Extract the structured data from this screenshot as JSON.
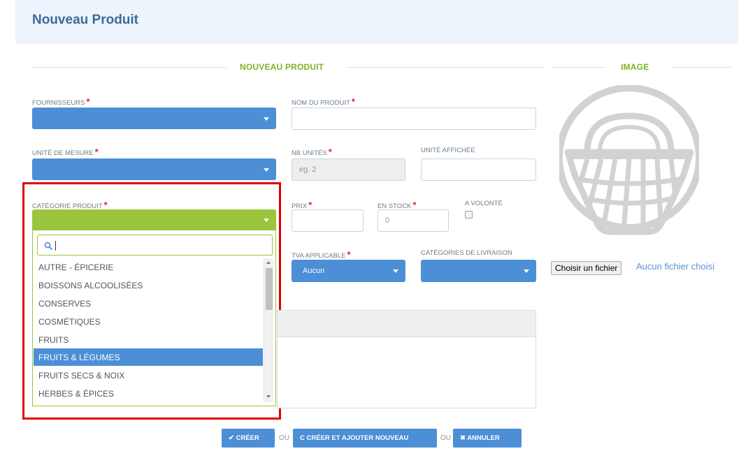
{
  "header": {
    "title": "Nouveau Produit"
  },
  "sections": {
    "product_title": "NOUVEAU PRODUIT",
    "image_title": "IMAGE"
  },
  "colors": {
    "accent_green": "#9bc53d",
    "primary_blue": "#4c8fd6",
    "required_red": "#e02a2a",
    "highlight_red": "#e00000"
  },
  "form": {
    "fournisseurs_label": "FOURNISSEURS",
    "nom_produit_label": "NOM DU PRODUIT",
    "unite_mesure_label": "UNITÉ DE MESURE",
    "nb_unites_label": "NB UNITÉS",
    "nb_unites_placeholder": "eg. 2",
    "unite_affichee_label": "UNITÉ AFFICHÉE",
    "categorie_label": "CATÉGORIE PRODUIT",
    "prix_label": "PRIX",
    "en_stock_label": "EN STOCK",
    "en_stock_value": "0",
    "a_volonte_label": "A VOLONTÉ",
    "tva_label": "TVA APPLICABLE",
    "tva_value": "Aucun",
    "livraison_label": "CATÉGORIES DE LIVRAISON",
    "required_mark": "*"
  },
  "dropdown": {
    "options": [
      "AUTRE - ÉPICERIE",
      "BOISSONS ALCOOLISÉES",
      "CONSERVES",
      "COSMÉTIQUES",
      "FRUITS",
      "FRUITS & LÉGUMES",
      "FRUITS SECS & NOIX",
      "HERBES & ÉPICES"
    ],
    "highlighted_index": 5
  },
  "image": {
    "icon": "basket-icon",
    "file_button": "Choisir un fichier",
    "file_status": "Aucun fichier choisi"
  },
  "actions": {
    "create": "CRÉER",
    "create_and_new": "CRÉER ET AJOUTER NOUVEAU",
    "cancel": "ANNULER",
    "separator": "OU"
  }
}
